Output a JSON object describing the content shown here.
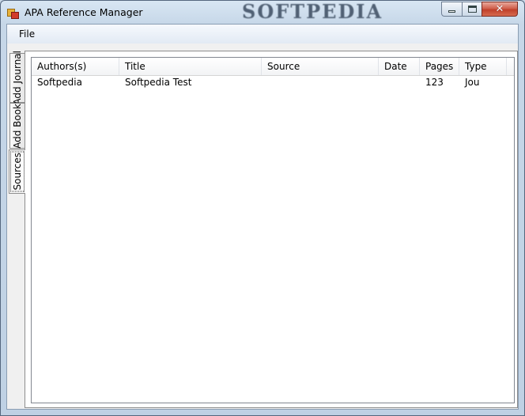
{
  "window": {
    "title": "APA Reference Manager",
    "watermark": "SOFTPEDIA"
  },
  "menubar": {
    "file_label": "File"
  },
  "tabs": [
    {
      "label": "Add Journal"
    },
    {
      "label": "Add Book"
    },
    {
      "label": "Sources",
      "active": true
    }
  ],
  "listview": {
    "columns": [
      "Authors(s)",
      "Title",
      "Source",
      "Date",
      "Pages",
      "Type"
    ],
    "rows": [
      {
        "authors": "Softpedia",
        "title": "Softpedia Test",
        "source": "",
        "date": "",
        "pages": "123",
        "type": "Jou"
      }
    ]
  },
  "colors": {
    "titlebar_bg": "#c6d7e8",
    "close_button": "#c0402a",
    "panel_bg": "#ffffff"
  },
  "icons": [
    "app-icon",
    "minimize-icon",
    "maximize-icon",
    "close-icon"
  ]
}
